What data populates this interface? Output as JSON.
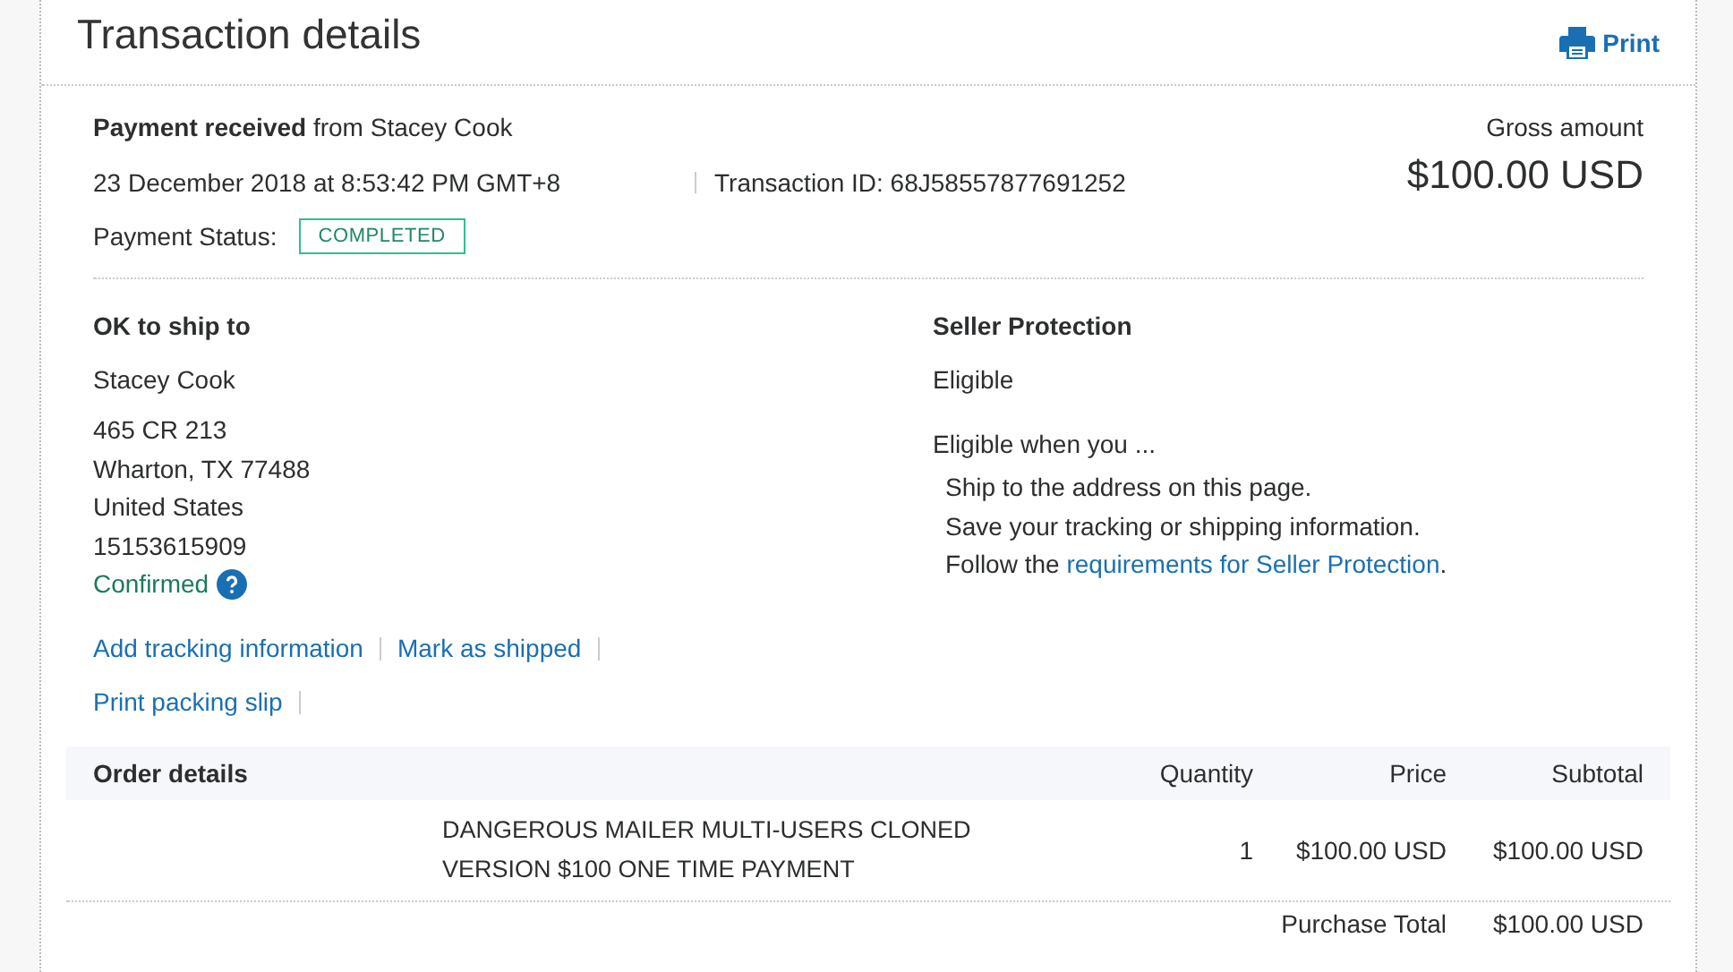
{
  "title": "Transaction details",
  "print_button": "Print",
  "summary": {
    "headline": "**Payment received** from Stacey Cook",
    "date": "23 December 2018 at 8:53:42 PM GMT+8",
    "transaction_id": "Transaction ID: 68J58557877691252",
    "status_label": "Payment Status:",
    "status": "COMPLETED",
    "gross_label": "Gross amount",
    "gross_amount": "$100.00 USD"
  },
  "ship_to": {
    "heading": "OK to ship to",
    "name": "Stacey Cook",
    "address_lines": [
      "465 CR 213",
      "Wharton, TX 77488",
      "United States",
      "15153615909"
    ],
    "confirmed": "Confirmed",
    "action_rows": [
      [
        "Add tracking information",
        "Mark as shipped"
      ],
      [
        "Print packing slip"
      ]
    ]
  },
  "seller_protection": {
    "heading": "Seller Protection",
    "status": "Eligible",
    "intro": "Eligible when you ...",
    "conditions": [
      {
        "kind": "text",
        "text": "Ship to the address on this page."
      },
      {
        "kind": "text",
        "text": "Save your tracking or shipping information."
      },
      {
        "kind": "link",
        "text": "Follow the ",
        "link": "requirements for Seller Protection",
        "after": "."
      }
    ]
  },
  "order": {
    "columns": [
      "Order details",
      "Quantity",
      "Price",
      "Subtotal"
    ],
    "rows": [
      {
        "description": "DANGEROUS MAILER MULTI-USERS CLONED VERSION $100 ONE TIME PAYMENT",
        "quantity": "1",
        "price": "$100.00 USD",
        "subtotal": "$100.00 USD"
      }
    ],
    "total_label": "Purchase Total",
    "total": "$100.00 USD"
  }
}
